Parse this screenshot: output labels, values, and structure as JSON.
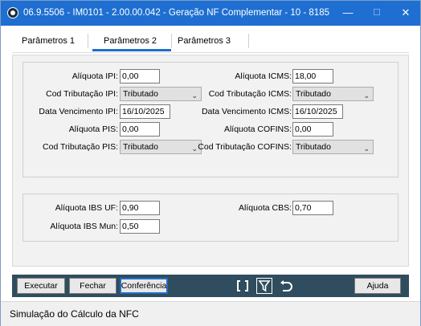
{
  "window": {
    "title": "06.9.5506 - IM0101 - 2.00.00.042 - Geração NF Complementar - 10 - 8185",
    "controls": {
      "minimize": "—",
      "maximize": "☐",
      "close": "✕"
    }
  },
  "tabs": [
    {
      "label": "Parâmetros 1"
    },
    {
      "label": "Parâmetros 2",
      "active": true
    },
    {
      "label": "Parâmetros 3"
    }
  ],
  "group1": {
    "left": [
      {
        "label": "Alíquota IPI:",
        "value": "0,00"
      },
      {
        "label": "Cod Tributação IPI:",
        "value": "Tributado"
      },
      {
        "label": "Data Vencimento IPI:",
        "value": "16/10/2025"
      },
      {
        "label": "Alíquota PIS:",
        "value": "0,00"
      },
      {
        "label": "Cod Tributação PIS:",
        "value": "Tributado"
      }
    ],
    "right": [
      {
        "label": "Alíquota ICMS:",
        "value": "18,00"
      },
      {
        "label": "Cod Tributação ICMS:",
        "value": "Tributado"
      },
      {
        "label": "Data Vencimento ICMS:",
        "value": "16/10/2025"
      },
      {
        "label": "Alíquota COFINS:",
        "value": "0,00"
      },
      {
        "label": "Cod Tributação COFINS:",
        "value": "Tributado"
      }
    ]
  },
  "group2": {
    "ibs_uf": {
      "label": "Alíquota IBS UF:",
      "value": "0,90"
    },
    "ibs_mun": {
      "label": "Alíquota IBS Mun:",
      "value": "0,50"
    },
    "cbs": {
      "label": "Alíquota CBS:",
      "value": "0,70"
    }
  },
  "toolbar": {
    "executar": "Executar",
    "fechar": "Fechar",
    "conferencia": "Conferência",
    "ajuda": "Ajuda",
    "icons": [
      "brackets-icon",
      "filter-icon",
      "undo-icon"
    ]
  },
  "status": {
    "text": "Simulação do Cálculo da NFC"
  },
  "colors": {
    "titlebar": "#1e6fd1",
    "toolbar": "#2f4d5e",
    "tab_active": "#1f6fc8"
  }
}
